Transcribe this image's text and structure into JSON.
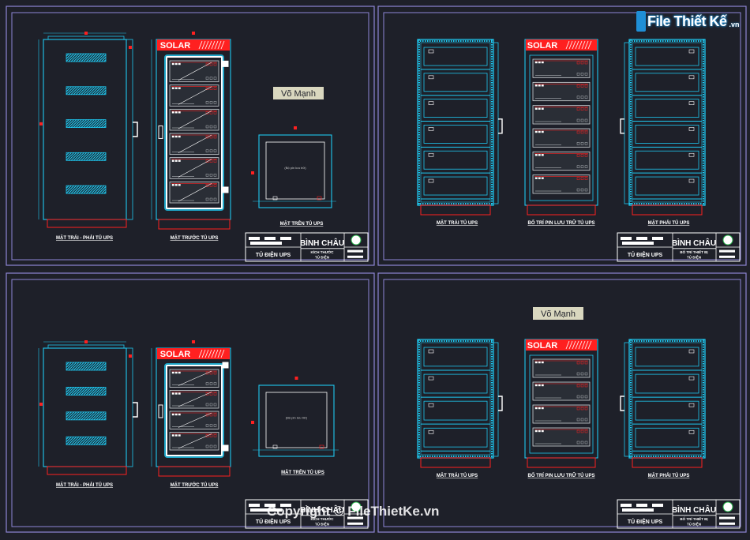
{
  "watermark_logo": {
    "text": "File Thiết Kế",
    "domain": ".vn"
  },
  "copyright": "Copyright © FileThietKe.vn",
  "colors": {
    "cyan": "#1fc8f0",
    "red": "#ff2020",
    "frame": "#8e86d6",
    "white": "#ffffff",
    "tag_bg": "#d9d7bf",
    "background": "#1e2029"
  },
  "sheets": [
    {
      "id": "tl",
      "views": [
        "MẶT TRÁI - PHẢI TỦ UPS",
        "MẶT TRƯỚC TỦ UPS",
        "MẶT TRÊN TỦ UPS"
      ],
      "panel_label": "SOLAR",
      "top_note": "(Bộ pin lưu trữ)",
      "tag": "Võ Mạnh",
      "title_block": {
        "project": "TỦ ĐIỆN UPS",
        "company": "BÌNH CHÂU",
        "desc_line1": "KÍCH THƯỚC",
        "desc_line2": "TỦ ĐIỆN"
      }
    },
    {
      "id": "tr",
      "views": [
        "MẶT TRÁI TỦ UPS",
        "BỐ TRÍ PIN LƯU TRỮ TỦ UPS",
        "MẶT PHẢI TỦ UPS"
      ],
      "panel_label": "SOLAR",
      "title_block": {
        "project": "TỦ ĐIỆN UPS",
        "company": "BÌNH CHÂU",
        "desc_line1": "BỐ TRÍ THIẾT BỊ",
        "desc_line2": "TỦ ĐIỆN"
      }
    },
    {
      "id": "bl",
      "views": [
        "MẶT TRÁI - PHẢI TỦ UPS",
        "MẶT TRƯỚC TỦ UPS",
        "MẶT TRÊN TỦ UPS"
      ],
      "panel_label": "SOLAR",
      "top_note": "(Bộ pin lưu trữ)",
      "title_block": {
        "project": "TỦ ĐIỆN UPS",
        "company": "BÌNH CHÂU",
        "desc_line1": "KÍCH THƯỚC",
        "desc_line2": "TỦ ĐIỆN"
      }
    },
    {
      "id": "br",
      "views": [
        "MẶT TRÁI TỦ UPS",
        "BỐ TRÍ PIN LƯU TRỮ TỦ UPS",
        "MẶT PHẢI TỦ UPS"
      ],
      "panel_label": "SOLAR",
      "tag": "Võ Mạnh",
      "title_block": {
        "project": "TỦ ĐIỆN UPS",
        "company": "BÌNH CHÂU",
        "desc_line1": "BỐ TRÍ THIẾT BỊ",
        "desc_line2": "TỦ ĐIỆN"
      }
    }
  ]
}
